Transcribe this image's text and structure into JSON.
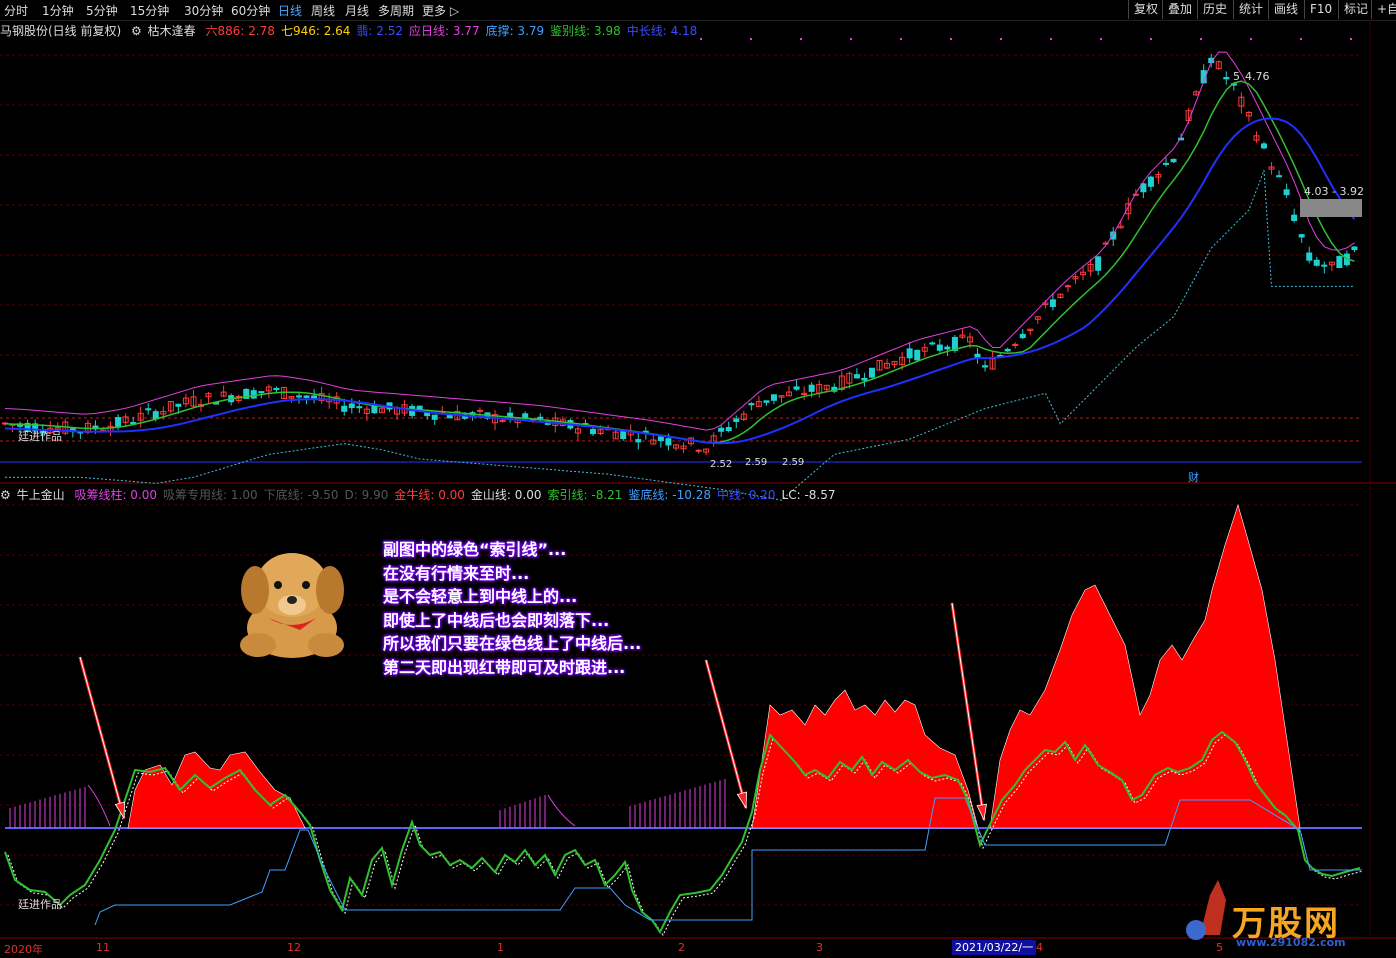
{
  "toolbar": {
    "periods": [
      "分时",
      "1分钟",
      "5分钟",
      "15分钟",
      "30分钟",
      "60分钟",
      "日线",
      "周线",
      "月线",
      "多周期",
      "更多 ▷"
    ],
    "active_period": "日线",
    "right_buttons": [
      "复权",
      "叠加",
      "历史",
      "统计",
      "画线",
      "F10",
      "标记",
      "+自"
    ]
  },
  "main_info": {
    "stock": "马钢股份(日线 前复权)",
    "indicator": "枯木逢春",
    "items": [
      {
        "label": "六886:",
        "value": "2.78",
        "color": "#ff3b3b"
      },
      {
        "label": "七946:",
        "value": "2.64",
        "color": "#ffd000"
      },
      {
        "label": "翡:",
        "value": "2.52",
        "color": "#3b4bff"
      },
      {
        "label": "应日线:",
        "value": "3.77",
        "color": "#e040e0"
      },
      {
        "label": "底撑:",
        "value": "3.79",
        "color": "#40a0ff"
      },
      {
        "label": "鉴别线:",
        "value": "3.98",
        "color": "#30c030"
      },
      {
        "label": "中长线:",
        "value": "4.18",
        "color": "#3b4bff"
      }
    ]
  },
  "main_chart": {
    "high_label": "4.76",
    "range_label": "4.03 - 3.92",
    "low_label_1": "2.52",
    "low_label_2": "2.59",
    "low_label_3": "2.59",
    "watermark_text": "廷进作品",
    "fin_label": "财"
  },
  "sub_info": {
    "title": "牛上金山",
    "items": [
      {
        "label": "吸筹线柱:",
        "value": "0.00",
        "color": "#e040e0"
      },
      {
        "label": "吸筹专用线:",
        "value": "1.00",
        "color": "#555555"
      },
      {
        "label": "下底线:",
        "value": "-9.50",
        "color": "#555555"
      },
      {
        "label": "D:",
        "value": "9.90",
        "color": "#555555"
      },
      {
        "label": "金牛线:",
        "value": "0.00",
        "color": "#ff3b3b"
      },
      {
        "label": "金山线:",
        "value": "0.00",
        "color": "#dddddd"
      },
      {
        "label": "索引线:",
        "value": "-8.21",
        "color": "#30c030"
      },
      {
        "label": "鉴底线:",
        "value": "-10.28",
        "color": "#40a0ff"
      },
      {
        "label": "中线:",
        "value": "0.20",
        "color": "#3b4bff"
      },
      {
        "label": "LC:",
        "value": "-8.57",
        "color": "#dddddd"
      }
    ],
    "watermark_text": "廷进作品"
  },
  "annotation": {
    "lines": [
      "副图中的绿色“索引线”...",
      "在没有行情来至时...",
      "是不会轻意上到中线上的...",
      "即使上了中线后也会即刻落下...",
      "所以我们只要在绿色线上了中线后...",
      "第二天即出现红带即可及时跟进..."
    ]
  },
  "xaxis": {
    "labels": [
      "2020年",
      "11",
      "12",
      "1",
      "2",
      "3",
      "4",
      "5"
    ],
    "cursor_date": "2021/03/22/一"
  },
  "watermark": {
    "brand": "万股网",
    "url": "www.291082.com"
  },
  "colors": {
    "up": "#ff3b3b",
    "down": "#20d0d0",
    "ma_green": "#30c030",
    "ma_blue": "#2030ff",
    "ma_magenta": "#e040e0",
    "area_red": "#ff0000"
  }
}
